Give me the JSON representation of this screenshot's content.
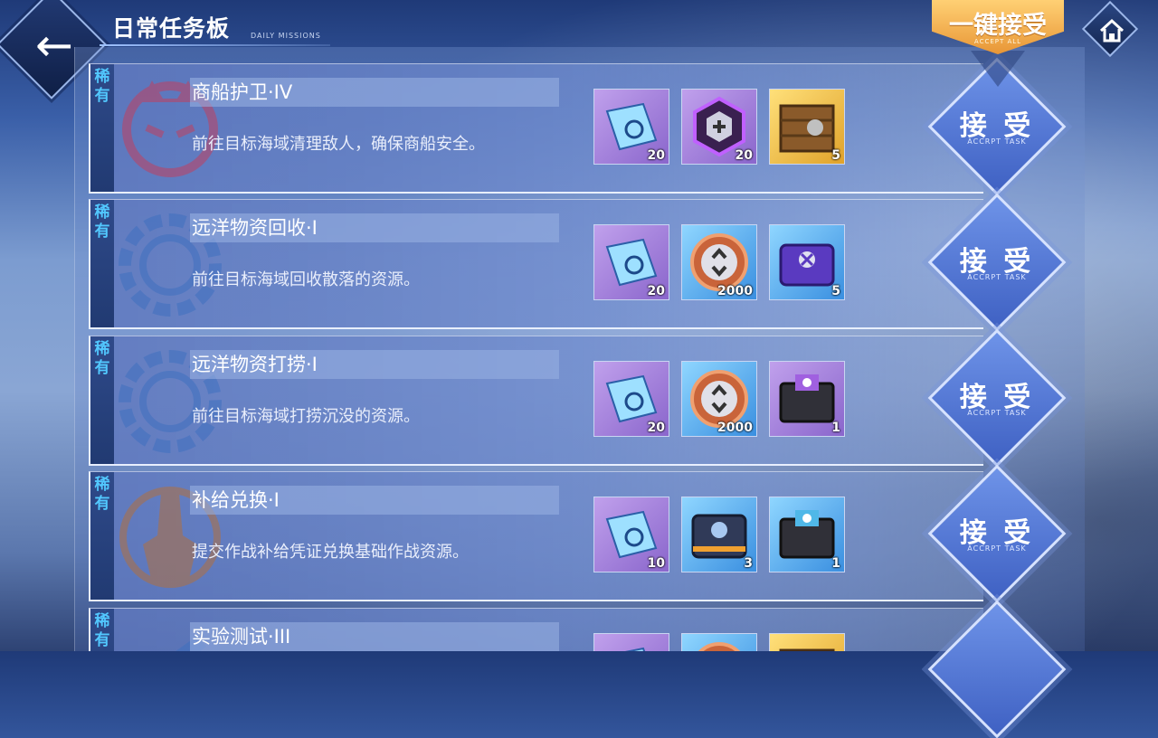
{
  "header": {
    "title": "日常任务板",
    "subtitle": "DAILY MISSIONS",
    "accept_all_label": "一键接受",
    "accept_all_sub": "ACCEPT ALL"
  },
  "accept_label": "接 受",
  "accept_sub": "ACCRPT TASK",
  "missions": [
    {
      "rarity": "稀有",
      "name": "商船护卫·IV",
      "desc": "前往目标海域清理敌人，确保商船安全。",
      "emblem": "demon-emblem-icon",
      "rewards": [
        {
          "icon": "blueprint-icon",
          "count": "20",
          "bg": "purple"
        },
        {
          "icon": "hex-core-icon",
          "count": "20",
          "bg": "purple"
        },
        {
          "icon": "wooden-crate-icon",
          "count": "5",
          "bg": "gold"
        }
      ]
    },
    {
      "rarity": "稀有",
      "name": "远洋物资回收·I",
      "desc": "前往目标海域回收散落的资源。",
      "emblem": "gear-emblem-icon",
      "rewards": [
        {
          "icon": "blueprint-icon",
          "count": "20",
          "bg": "purple"
        },
        {
          "icon": "coin-icon",
          "count": "2000",
          "bg": "blue"
        },
        {
          "icon": "tool-case-icon",
          "count": "5",
          "bg": "blue"
        }
      ]
    },
    {
      "rarity": "稀有",
      "name": "远洋物资打捞·I",
      "desc": "前往目标海域打捞沉没的资源。",
      "emblem": "gear-emblem-icon",
      "rewards": [
        {
          "icon": "blueprint-icon",
          "count": "20",
          "bg": "purple"
        },
        {
          "icon": "coin-icon",
          "count": "2000",
          "bg": "blue"
        },
        {
          "icon": "supply-chest-icon",
          "count": "1",
          "bg": "purple"
        }
      ]
    },
    {
      "rarity": "稀有",
      "name": "补给兑换·I",
      "desc": "提交作战补给凭证兑换基础作战资源。",
      "emblem": "ship-emblem-icon",
      "rewards": [
        {
          "icon": "blueprint-icon",
          "count": "10",
          "bg": "purple"
        },
        {
          "icon": "supply-box-icon",
          "count": "3",
          "bg": "blue"
        },
        {
          "icon": "supply-chest-icon",
          "count": "1",
          "bg": "blue"
        }
      ]
    },
    {
      "rarity": "稀有",
      "name": "实验测试·III",
      "desc": "",
      "emblem": "cannon-emblem-icon",
      "rewards": [
        {
          "icon": "blueprint-icon",
          "count": "",
          "bg": "purple"
        },
        {
          "icon": "coin-icon",
          "count": "",
          "bg": "blue"
        },
        {
          "icon": "wooden-crate-icon",
          "count": "",
          "bg": "gold"
        }
      ]
    }
  ]
}
